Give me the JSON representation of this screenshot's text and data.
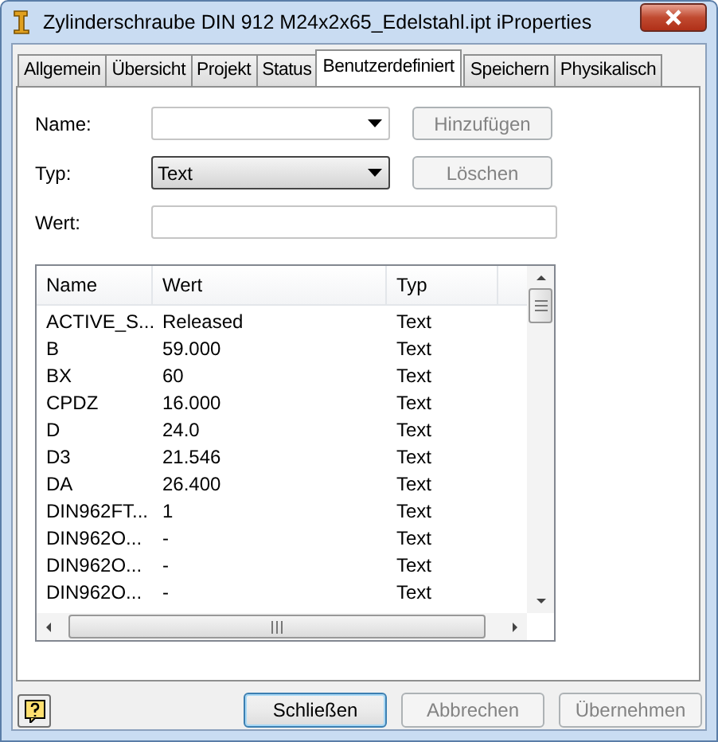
{
  "window": {
    "title": "Zylinderschraube DIN 912 M24x2x65_Edelstahl.ipt iProperties"
  },
  "tabs": [
    {
      "label": "Allgemein",
      "selected": false
    },
    {
      "label": "Übersicht",
      "selected": false
    },
    {
      "label": "Projekt",
      "selected": false
    },
    {
      "label": "Status",
      "selected": false
    },
    {
      "label": "Benutzerdefiniert",
      "selected": true
    },
    {
      "label": "Speichern",
      "selected": false
    },
    {
      "label": "Physikalisch",
      "selected": false
    }
  ],
  "form": {
    "fields": [
      {
        "label": "Name:",
        "kind": "editable-combo",
        "button": {
          "label": "Hinzufügen",
          "disabled": true
        }
      },
      {
        "label": "Typ:",
        "kind": "dropdown",
        "value": "Text",
        "button": {
          "label": "Löschen",
          "disabled": true
        }
      },
      {
        "label": "Wert:",
        "kind": "text"
      }
    ]
  },
  "table": {
    "columns": [
      "Name",
      "Wert",
      "Typ"
    ],
    "rows": [
      [
        "ACTIVE_S...",
        "Released",
        "Text"
      ],
      [
        "B",
        "59.000",
        "Text"
      ],
      [
        "BX",
        "60",
        "Text"
      ],
      [
        "CPDZ",
        "16.000",
        "Text"
      ],
      [
        "D",
        "24.0",
        "Text"
      ],
      [
        "D3",
        "21.546",
        "Text"
      ],
      [
        "DA",
        "26.400",
        "Text"
      ],
      [
        "DIN962FT...",
        "1",
        "Text"
      ],
      [
        "DIN962O...",
        "-",
        "Text"
      ],
      [
        "DIN962O...",
        "-",
        "Text"
      ],
      [
        "DIN962O...",
        "-",
        "Text"
      ]
    ]
  },
  "buttons": [
    {
      "label": "Schließen",
      "disabled": false,
      "default": true
    },
    {
      "label": "Abbrechen",
      "disabled": true,
      "default": false
    },
    {
      "label": "Übernehmen",
      "disabled": true,
      "default": false
    }
  ]
}
